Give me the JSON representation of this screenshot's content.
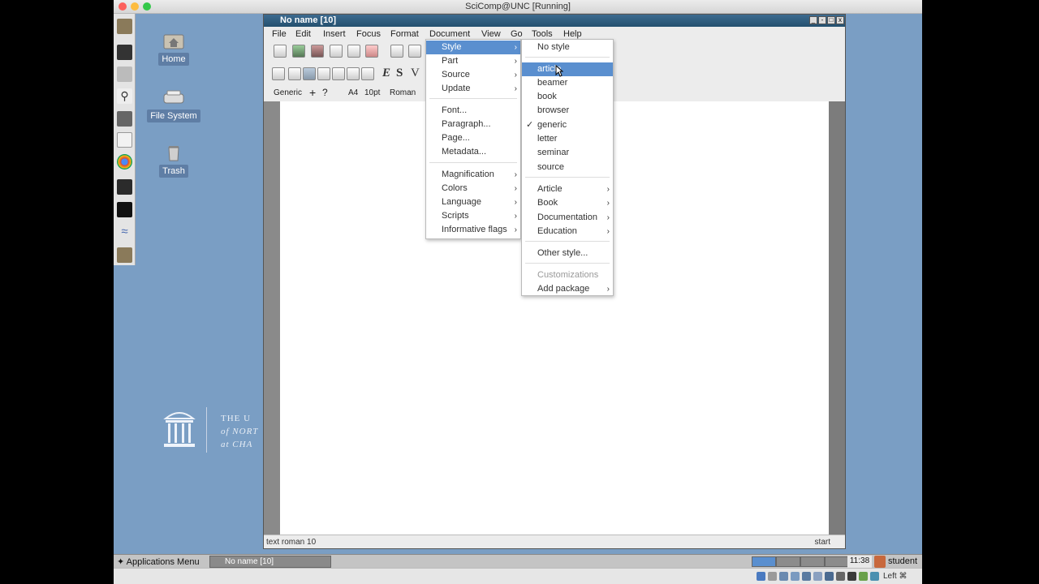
{
  "host": {
    "title": "SciComp@UNC [Running]"
  },
  "desktop": {
    "icons": [
      {
        "label": "Home"
      },
      {
        "label": "File System"
      },
      {
        "label": "Trash"
      }
    ],
    "logo_lines": [
      "THE U",
      "of NORT",
      "at CHA"
    ]
  },
  "app": {
    "title": "No name [10]",
    "menus": [
      "File",
      "Edit",
      "Insert",
      "Focus",
      "Format",
      "Document",
      "View",
      "Go",
      "Tools",
      "Help"
    ],
    "mode_bar": {
      "style": "Generic",
      "paper": "A4",
      "size": "10pt",
      "font": "Roman"
    },
    "status_left": "text roman 10",
    "status_right": "start"
  },
  "document_menu": {
    "items": [
      "Style",
      "Part",
      "Source",
      "Update",
      "Font...",
      "Paragraph...",
      "Page...",
      "Metadata...",
      "Magnification",
      "Colors",
      "Language",
      "Scripts",
      "Informative flags"
    ],
    "highlighted": "Style"
  },
  "style_submenu": {
    "items": [
      "No style",
      "article",
      "beamer",
      "book",
      "browser",
      "generic",
      "letter",
      "seminar",
      "source",
      "Article",
      "Book",
      "Documentation",
      "Education",
      "Other style...",
      "Customizations",
      "Add package"
    ],
    "highlighted": "article",
    "checked": "generic",
    "disabled": "Customizations"
  },
  "taskbar": {
    "apps_menu": "Applications Menu",
    "window": "No name [10]",
    "clock": "11:38",
    "user": "student"
  },
  "vbox": {
    "hostkey": "Left ⌘"
  },
  "colors": {
    "desktop": "#7a9ec4",
    "highlight": "#5a8fcf",
    "titlebar": "#24506f"
  }
}
